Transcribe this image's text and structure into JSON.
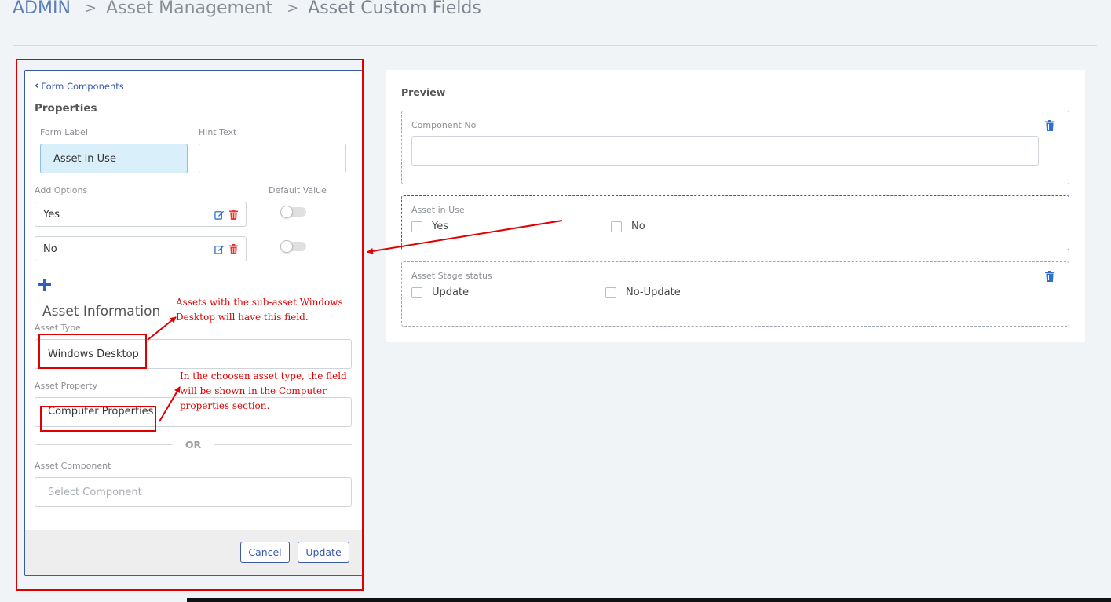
{
  "breadcrumb": {
    "items": [
      "ADMIN",
      "Asset Management",
      "Asset Custom Fields"
    ],
    "separator": ">"
  },
  "panel": {
    "back_link": "Form Components",
    "properties_title": "Properties",
    "form_label": {
      "label": "Form Label",
      "value": "Asset in Use"
    },
    "hint_text": {
      "label": "Hint Text",
      "value": ""
    },
    "add_options_label": "Add Options",
    "default_value_label": "Default Value",
    "options": [
      {
        "value": "Yes",
        "default": false
      },
      {
        "value": "No",
        "default": false
      }
    ],
    "section_title": "Asset Information",
    "asset_type": {
      "label": "Asset Type",
      "value": "Windows Desktop"
    },
    "asset_property": {
      "label": "Asset Property",
      "value": "Computer Properties"
    },
    "or_text": "OR",
    "asset_component": {
      "label": "Asset Component",
      "placeholder": "Select Component"
    },
    "cancel_label": "Cancel",
    "update_label": "Update"
  },
  "annotations": {
    "note1": "Assets with the sub-asset Windows Desktop will have this field.",
    "note2": "In the choosen asset type, the field will be shown in the Computer properties section."
  },
  "preview": {
    "title": "Preview",
    "components": [
      {
        "label": "Component No",
        "type": "text"
      },
      {
        "label": "Asset in Use",
        "type": "checkbox",
        "options": [
          "Yes",
          "No"
        ]
      },
      {
        "label": "Asset Stage status",
        "type": "checkbox",
        "options": [
          "Update",
          "No-Update"
        ]
      }
    ]
  },
  "colors": {
    "accent": "#3a5aa8",
    "annotation_red": "#e00000",
    "focus_fill": "#d9f0fb",
    "delete_red": "#e53935"
  }
}
